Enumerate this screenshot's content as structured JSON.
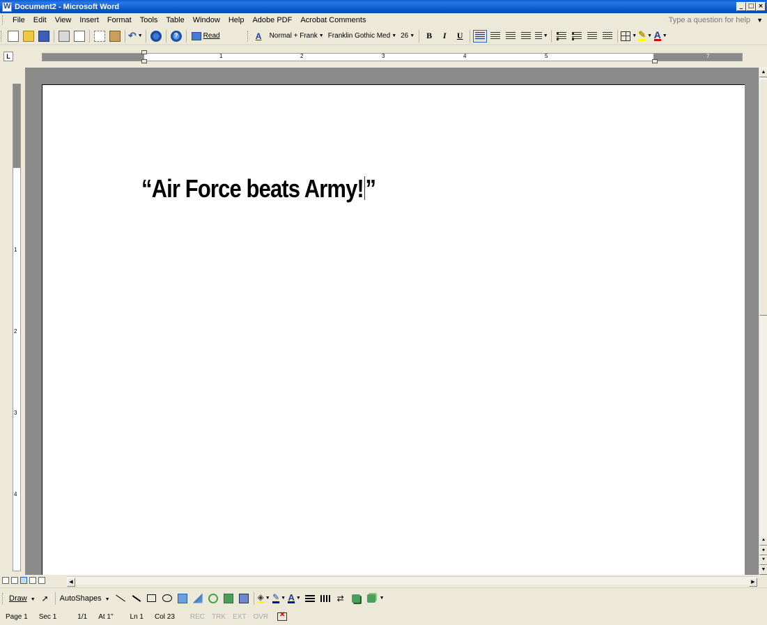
{
  "window": {
    "title": "Document2 - Microsoft Word",
    "min_label": "_",
    "max_label": "□",
    "close_label": "×"
  },
  "menu": {
    "items": [
      "File",
      "Edit",
      "View",
      "Insert",
      "Format",
      "Tools",
      "Table",
      "Window",
      "Help",
      "Adobe PDF",
      "Acrobat Comments"
    ],
    "help_placeholder": "Type a question for help"
  },
  "toolbar": {
    "read_label": "Read",
    "style_value": "Normal + Frank",
    "font_value": "Franklin Gothic Med",
    "size_value": "26",
    "bold_label": "B",
    "italic_label": "I",
    "underline_label": "U"
  },
  "ruler": {
    "numbers": [
      "1",
      "2",
      "3",
      "4",
      "5",
      "7"
    ],
    "vertical_numbers": [
      "1",
      "2",
      "3",
      "4"
    ]
  },
  "document": {
    "text_before_caret": "“Air Force beats Army!",
    "text_after_caret": "”"
  },
  "drawing": {
    "draw_label": "Draw",
    "autoshapes_label": "AutoShapes"
  },
  "status": {
    "page": "Page 1",
    "sec": "Sec 1",
    "pages": "1/1",
    "at": "At 1\"",
    "ln": "Ln 1",
    "col": "Col 23",
    "rec": "REC",
    "trk": "TRK",
    "ext": "EXT",
    "ovr": "OVR"
  },
  "colors": {
    "titlebar": "#0a5fd8",
    "chrome": "#ece9d8",
    "workspace": "#8a8a8a",
    "page": "#ffffff"
  }
}
